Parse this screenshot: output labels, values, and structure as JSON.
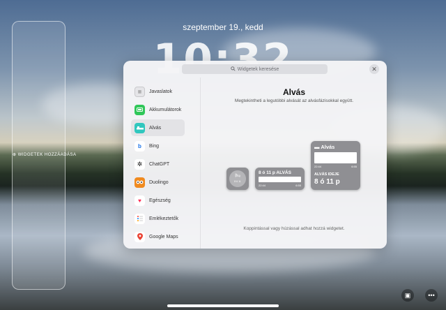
{
  "lockscreen": {
    "date": "szeptember 19., kedd",
    "time": "10:32",
    "add_widget_label": "WIDGETEK HOZZÁADÁSA"
  },
  "panel": {
    "search_placeholder": "Widgetek keresése",
    "search_icon": "magnifier-icon",
    "close_icon": "close-icon",
    "sidebar": [
      {
        "label": "Javaslatok",
        "icon": "suggestions-icon",
        "color": "#c9c9cc",
        "active": false
      },
      {
        "label": "Akkumulátorok",
        "icon": "battery-icon",
        "color": "#30c759",
        "active": false
      },
      {
        "label": "Alvás",
        "icon": "bed-icon",
        "color": "#30c7be",
        "active": true
      },
      {
        "label": "Bing",
        "icon": "bing-icon",
        "color": "#ffffff",
        "active": false
      },
      {
        "label": "ChatGPT",
        "icon": "chatgpt-icon",
        "color": "#ffffff",
        "active": false
      },
      {
        "label": "Duolingo",
        "icon": "duolingo-icon",
        "color": "#f08a1f",
        "active": false
      },
      {
        "label": "Egészség",
        "icon": "heart-icon",
        "color": "#ffffff",
        "active": false
      },
      {
        "label": "Emlékeztetők",
        "icon": "reminders-icon",
        "color": "#ffffff",
        "active": false
      },
      {
        "label": "Google Maps",
        "icon": "maps-pin-icon",
        "color": "#ffffff",
        "active": false
      }
    ],
    "detail": {
      "title": "Alvás",
      "description": "Megtekintheti a legutóbbi alvását az alvásfázisokkal együtt.",
      "hint": "Koppintással vagy húzással adhat hozzá widgetet.",
      "widgets": {
        "small": {
          "bed": "🛏",
          "sub": "8 6 11"
        },
        "medium": {
          "headline": "8 ó 11 p ALVÁS",
          "start": "22:44",
          "end": "6:55"
        },
        "large": {
          "title": "Alvás",
          "start": "22:44",
          "end": "6:55",
          "label": "ALVÁS IDEJE",
          "value": "8 ó 11 p"
        }
      }
    }
  },
  "colors": {
    "panel_bg": "#f4f4f6",
    "widget_gray": "#8f8f93"
  }
}
